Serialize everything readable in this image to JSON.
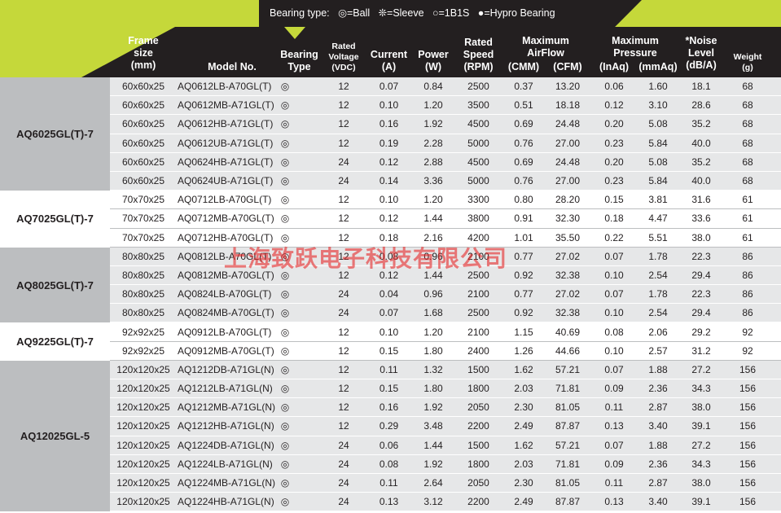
{
  "legend": "Bearing type:   ◎=Ball   ❊=Sleeve   ○=1B1S   ●=Hypro Bearing",
  "headers": {
    "frame_size": "Frame\nsize\n(mm)",
    "model_no": "Model No.",
    "bearing_type": "Bearing\nType",
    "rated_voltage": "Rated\nVoltage\n(VDC)",
    "current": "Current\n(A)",
    "power": "Power\n(W)",
    "rated_speed": "Rated\nSpeed\n(RPM)",
    "max_airflow": "Maximum\nAirFlow",
    "cmm": "(CMM)",
    "cfm": "(CFM)",
    "max_pressure": "Maximum\nPressure",
    "inaq": "(InAq)",
    "mmaq": "(mmAq)",
    "noise": "*Noise\nLevel\n(dB/A)",
    "weight": "Weight\n(g)"
  },
  "groups": [
    {
      "label": "AQ6025GL(T)-7",
      "style": "gray",
      "rows": [
        [
          "60x60x25",
          "AQ0612LB-A70GL(T)",
          "◎",
          "12",
          "0.07",
          "0.84",
          "2500",
          "0.37",
          "13.20",
          "0.06",
          "1.60",
          "18.1",
          "68"
        ],
        [
          "60x60x25",
          "AQ0612MB-A71GL(T)",
          "◎",
          "12",
          "0.10",
          "1.20",
          "3500",
          "0.51",
          "18.18",
          "0.12",
          "3.10",
          "28.6",
          "68"
        ],
        [
          "60x60x25",
          "AQ0612HB-A71GL(T)",
          "◎",
          "12",
          "0.16",
          "1.92",
          "4500",
          "0.69",
          "24.48",
          "0.20",
          "5.08",
          "35.2",
          "68"
        ],
        [
          "60x60x25",
          "AQ0612UB-A71GL(T)",
          "◎",
          "12",
          "0.19",
          "2.28",
          "5000",
          "0.76",
          "27.00",
          "0.23",
          "5.84",
          "40.0",
          "68"
        ],
        [
          "60x60x25",
          "AQ0624HB-A71GL(T)",
          "◎",
          "24",
          "0.12",
          "2.88",
          "4500",
          "0.69",
          "24.48",
          "0.20",
          "5.08",
          "35.2",
          "68"
        ],
        [
          "60x60x25",
          "AQ0624UB-A71GL(T)",
          "◎",
          "24",
          "0.14",
          "3.36",
          "5000",
          "0.76",
          "27.00",
          "0.23",
          "5.84",
          "40.0",
          "68"
        ]
      ]
    },
    {
      "label": "AQ7025GL(T)-7",
      "style": "white",
      "rows": [
        [
          "70x70x25",
          "AQ0712LB-A70GL(T)",
          "◎",
          "12",
          "0.10",
          "1.20",
          "3300",
          "0.80",
          "28.20",
          "0.15",
          "3.81",
          "31.6",
          "61"
        ],
        [
          "70x70x25",
          "AQ0712MB-A70GL(T)",
          "◎",
          "12",
          "0.12",
          "1.44",
          "3800",
          "0.91",
          "32.30",
          "0.18",
          "4.47",
          "33.6",
          "61"
        ],
        [
          "70x70x25",
          "AQ0712HB-A70GL(T)",
          "◎",
          "12",
          "0.18",
          "2.16",
          "4200",
          "1.01",
          "35.50",
          "0.22",
          "5.51",
          "38.0",
          "61"
        ]
      ]
    },
    {
      "label": "AQ8025GL(T)-7",
      "style": "gray",
      "rows": [
        [
          "80x80x25",
          "AQ0812LB-A70GL(T)",
          "◎",
          "12",
          "0.08",
          "0.96",
          "2100",
          "0.77",
          "27.02",
          "0.07",
          "1.78",
          "22.3",
          "86"
        ],
        [
          "80x80x25",
          "AQ0812MB-A70GL(T)",
          "◎",
          "12",
          "0.12",
          "1.44",
          "2500",
          "0.92",
          "32.38",
          "0.10",
          "2.54",
          "29.4",
          "86"
        ],
        [
          "80x80x25",
          "AQ0824LB-A70GL(T)",
          "◎",
          "24",
          "0.04",
          "0.96",
          "2100",
          "0.77",
          "27.02",
          "0.07",
          "1.78",
          "22.3",
          "86"
        ],
        [
          "80x80x25",
          "AQ0824MB-A70GL(T)",
          "◎",
          "24",
          "0.07",
          "1.68",
          "2500",
          "0.92",
          "32.38",
          "0.10",
          "2.54",
          "29.4",
          "86"
        ]
      ]
    },
    {
      "label": "AQ9225GL(T)-7",
      "style": "white",
      "rows": [
        [
          "92x92x25",
          "AQ0912LB-A70GL(T)",
          "◎",
          "12",
          "0.10",
          "1.20",
          "2100",
          "1.15",
          "40.69",
          "0.08",
          "2.06",
          "29.2",
          "92"
        ],
        [
          "92x92x25",
          "AQ0912MB-A70GL(T)",
          "◎",
          "12",
          "0.15",
          "1.80",
          "2400",
          "1.26",
          "44.66",
          "0.10",
          "2.57",
          "31.2",
          "92"
        ]
      ]
    },
    {
      "label": "AQ12025GL-5",
      "style": "gray",
      "rows": [
        [
          "120x120x25",
          "AQ1212DB-A71GL(N)",
          "◎",
          "12",
          "0.11",
          "1.32",
          "1500",
          "1.62",
          "57.21",
          "0.07",
          "1.88",
          "27.2",
          "156"
        ],
        [
          "120x120x25",
          "AQ1212LB-A71GL(N)",
          "◎",
          "12",
          "0.15",
          "1.80",
          "1800",
          "2.03",
          "71.81",
          "0.09",
          "2.36",
          "34.3",
          "156"
        ],
        [
          "120x120x25",
          "AQ1212MB-A71GL(N)",
          "◎",
          "12",
          "0.16",
          "1.92",
          "2050",
          "2.30",
          "81.05",
          "0.11",
          "2.87",
          "38.0",
          "156"
        ],
        [
          "120x120x25",
          "AQ1212HB-A71GL(N)",
          "◎",
          "12",
          "0.29",
          "3.48",
          "2200",
          "2.49",
          "87.87",
          "0.13",
          "3.40",
          "39.1",
          "156"
        ],
        [
          "120x120x25",
          "AQ1224DB-A71GL(N)",
          "◎",
          "24",
          "0.06",
          "1.44",
          "1500",
          "1.62",
          "57.21",
          "0.07",
          "1.88",
          "27.2",
          "156"
        ],
        [
          "120x120x25",
          "AQ1224LB-A71GL(N)",
          "◎",
          "24",
          "0.08",
          "1.92",
          "1800",
          "2.03",
          "71.81",
          "0.09",
          "2.36",
          "34.3",
          "156"
        ],
        [
          "120x120x25",
          "AQ1224MB-A71GL(N)",
          "◎",
          "24",
          "0.11",
          "2.64",
          "2050",
          "2.30",
          "81.05",
          "0.11",
          "2.87",
          "38.0",
          "156"
        ],
        [
          "120x120x25",
          "AQ1224HB-A71GL(N)",
          "◎",
          "24",
          "0.13",
          "3.12",
          "2200",
          "2.49",
          "87.87",
          "0.13",
          "3.40",
          "39.1",
          "156"
        ]
      ]
    }
  ],
  "watermark": "上海致跃电子科技有限公司",
  "colors": {
    "accent": "#c5d83a",
    "header": "#231f20",
    "gray_row": "#e6e7e8",
    "gray_label": "#bcbec0",
    "watermark": "#e62828"
  }
}
